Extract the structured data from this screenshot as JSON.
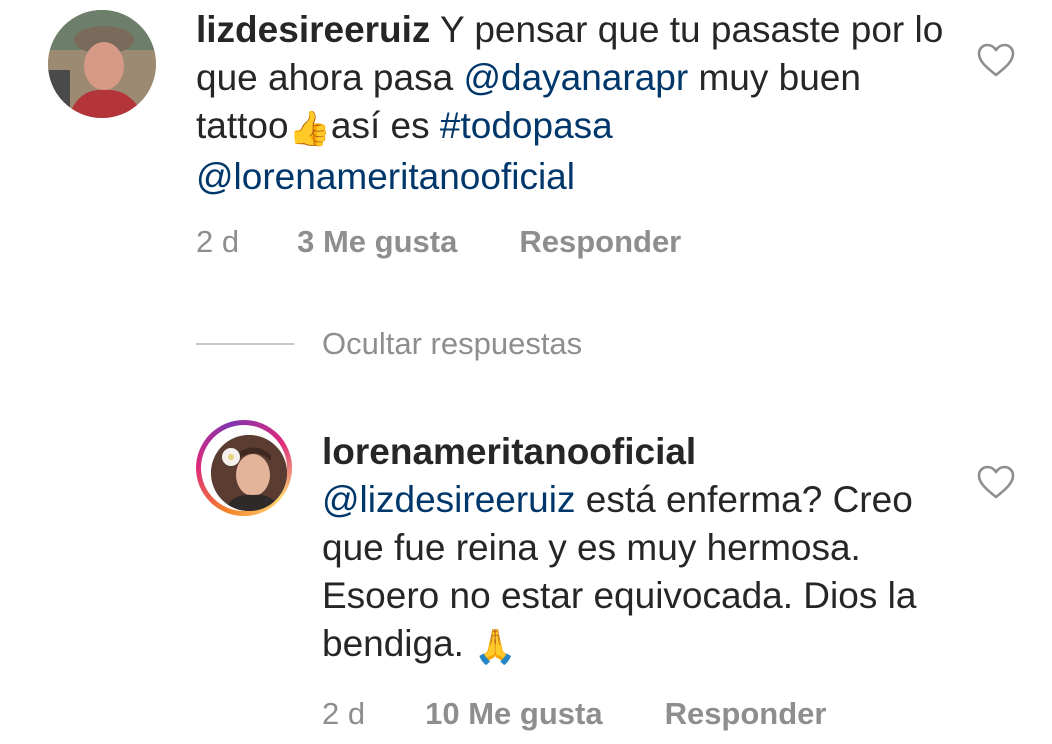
{
  "comments": [
    {
      "username": "lizdesireeruiz",
      "text_parts": [
        {
          "t": " Y pensar que tu pasaste por lo que ahora pasa "
        },
        {
          "t": "@dayanarapr",
          "kind": "mention"
        },
        {
          "t": " muy buen  tattoo"
        },
        {
          "t": "👍",
          "kind": "emoji"
        },
        {
          "t": "así es "
        },
        {
          "t": "#todopasa",
          "kind": "hashtag"
        },
        {
          "t": " "
        },
        {
          "t": "@lorenameritanooficial",
          "kind": "mention"
        }
      ],
      "time": "2 d",
      "likes": "3 Me gusta",
      "reply": "Responder",
      "like_icon": "heart-outline-icon"
    },
    {
      "username": "lorenameritanooficial",
      "text_parts": [
        {
          "t": "@lizdesireeruiz",
          "kind": "mention"
        },
        {
          "t": " está enferma? Creo que fue reina y es muy hermosa. Esoero no estar equivocada. Dios la bendiga. "
        },
        {
          "t": "🙏",
          "kind": "emoji"
        }
      ],
      "time": "2 d",
      "likes": "10 Me gusta",
      "reply": "Responder",
      "like_icon": "heart-outline-icon"
    }
  ],
  "hide_replies": "Ocultar respuestas",
  "colors": {
    "text": "#262626",
    "link": "#00376b",
    "meta": "#8e8e8e",
    "divider": "#c7c7c7"
  }
}
